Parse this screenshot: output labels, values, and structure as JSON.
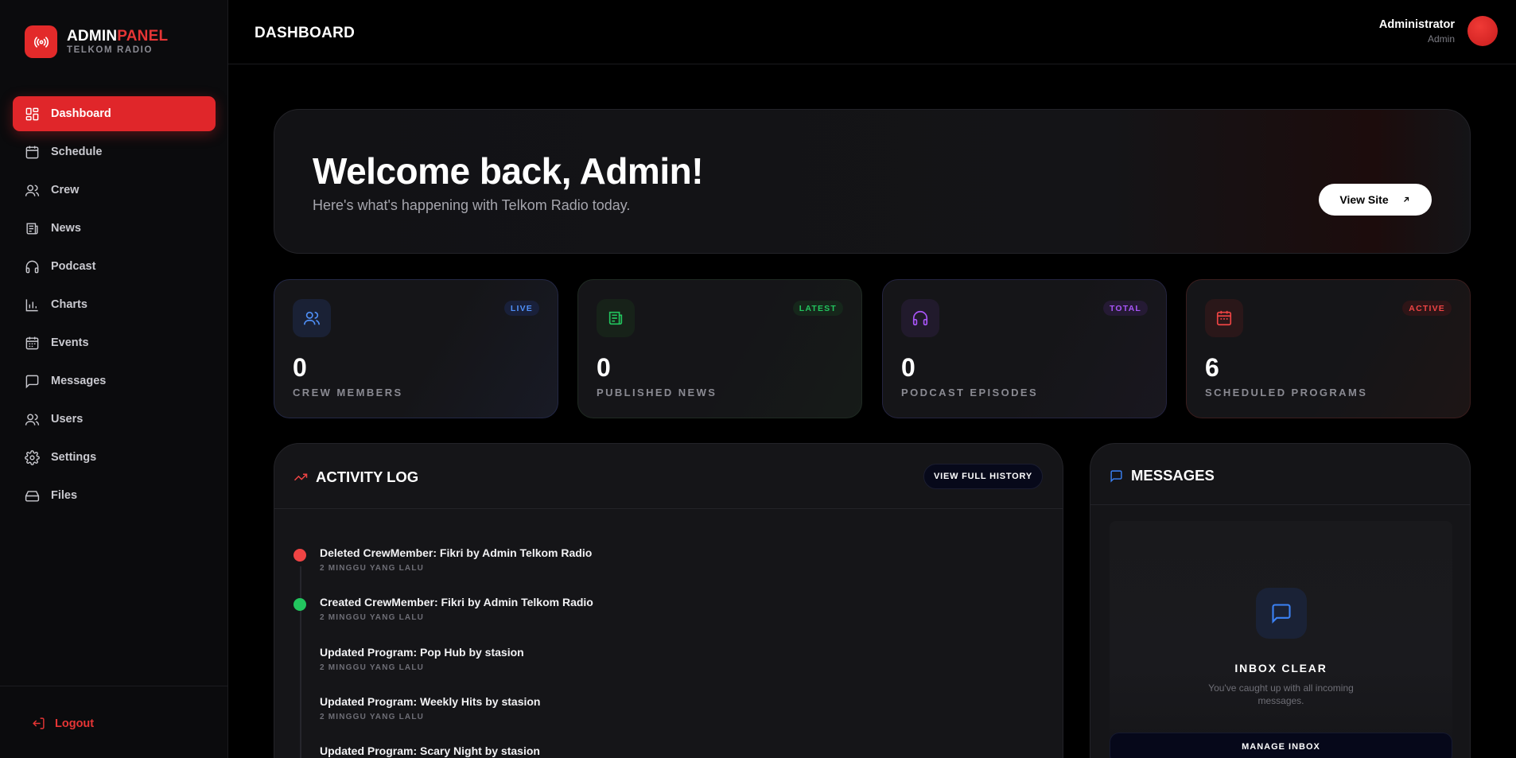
{
  "brand": {
    "name_a": "ADMIN",
    "name_b": "PANEL",
    "subtitle": "TELKOM RADIO"
  },
  "sidebar": {
    "items": [
      {
        "label": "Dashboard",
        "icon": "dashboard-icon",
        "active": true
      },
      {
        "label": "Schedule",
        "icon": "calendar-icon"
      },
      {
        "label": "Crew",
        "icon": "users-icon"
      },
      {
        "label": "News",
        "icon": "newspaper-icon"
      },
      {
        "label": "Podcast",
        "icon": "headphones-icon"
      },
      {
        "label": "Charts",
        "icon": "bar-chart-icon"
      },
      {
        "label": "Events",
        "icon": "calendar-grid-icon"
      },
      {
        "label": "Messages",
        "icon": "message-icon"
      },
      {
        "label": "Users",
        "icon": "users-icon"
      },
      {
        "label": "Settings",
        "icon": "gear-icon"
      },
      {
        "label": "Files",
        "icon": "drive-icon"
      }
    ],
    "logout": "Logout"
  },
  "topbar": {
    "title": "DASHBOARD",
    "user_name": "Administrator",
    "user_role": "Admin"
  },
  "welcome": {
    "heading": "Welcome back, Admin!",
    "subheading": "Here's what's happening with Telkom Radio today.",
    "button": "View Site"
  },
  "stats": [
    {
      "value": "0",
      "label": "CREW MEMBERS",
      "badge": "LIVE",
      "accent": "#3b82f6"
    },
    {
      "value": "0",
      "label": "PUBLISHED NEWS",
      "badge": "LATEST",
      "accent": "#22c55e"
    },
    {
      "value": "0",
      "label": "PODCAST EPISODES",
      "badge": "TOTAL",
      "accent": "#a855f7"
    },
    {
      "value": "6",
      "label": "SCHEDULED PROGRAMS",
      "badge": "ACTIVE",
      "accent": "#ef4444"
    }
  ],
  "activity": {
    "title": "ACTIVITY LOG",
    "button": "VIEW FULL HISTORY",
    "items": [
      {
        "text": "Deleted CrewMember: Fikri by Admin Telkom Radio",
        "time": "2 MINGGU YANG LALU",
        "dot": "#ef4444"
      },
      {
        "text": "Created CrewMember: Fikri by Admin Telkom Radio",
        "time": "2 MINGGU YANG LALU",
        "dot": "#22c55e"
      },
      {
        "text": "Updated Program: Pop Hub by stasion",
        "time": "2 MINGGU YANG LALU"
      },
      {
        "text": "Updated Program: Weekly Hits by stasion",
        "time": "2 MINGGU YANG LALU"
      },
      {
        "text": "Updated Program: Scary Night by stasion",
        "time": ""
      }
    ]
  },
  "messages": {
    "title": "MESSAGES",
    "empty_title": "INBOX CLEAR",
    "empty_text": "You've caught up with all incoming messages.",
    "button": "MANAGE INBOX"
  }
}
